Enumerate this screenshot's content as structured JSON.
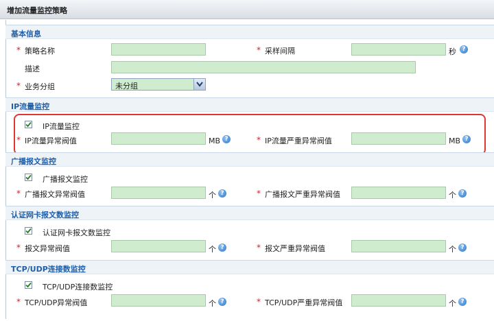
{
  "window": {
    "title": "增加流量监控策略"
  },
  "basic": {
    "header": "基本信息",
    "policy_name_label": "策略名称",
    "policy_name_value": "",
    "sample_interval_label": "采样间隔",
    "sample_interval_value": "",
    "sample_interval_unit": "秒",
    "desc_label": "描述",
    "desc_value": "",
    "group_label": "业务分组",
    "group_value": "未分组"
  },
  "ip": {
    "header": "IP流量监控",
    "checkbox_label": "IP流量监控",
    "checked": true,
    "abnormal_label": "IP流量异常阀值",
    "abnormal_unit": "MB",
    "severe_label": "IP流量严重异常阀值",
    "severe_unit": "MB"
  },
  "broadcast": {
    "header": "广播报文监控",
    "checkbox_label": "广播报文监控",
    "checked": true,
    "abnormal_label": "广播报文异常阀值",
    "abnormal_unit": "个",
    "severe_label": "广播报文严重异常阀值",
    "severe_unit": "个"
  },
  "auth": {
    "header": "认证网卡报文数监控",
    "checkbox_label": "认证网卡报文数监控",
    "checked": true,
    "abnormal_label": "报文异常阀值",
    "abnormal_unit": "个",
    "severe_label": "报文严重异常阀值",
    "severe_unit": "个"
  },
  "tcp": {
    "header": "TCP/UDP连接数监控",
    "checkbox_label": "TCP/UDP连接数监控",
    "checked": true,
    "abnormal_label": "TCP/UDP异常阀值",
    "abnormal_unit": "个",
    "severe_label": "TCP/UDP严重异常阀值",
    "severe_unit": "个"
  },
  "common": {
    "required_mark": "*",
    "help_glyph": "?"
  },
  "colors": {
    "accent": "#1f5ea8",
    "input_bg": "#cfeccf",
    "required": "#c8252c",
    "highlight": "#e0362f"
  }
}
